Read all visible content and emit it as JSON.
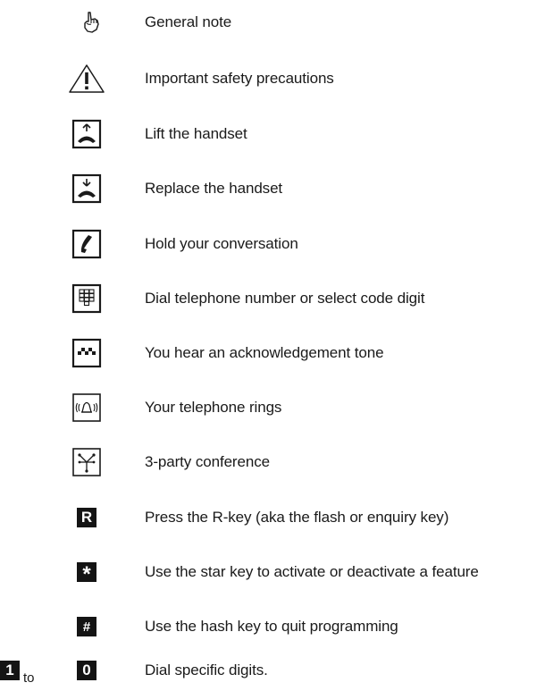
{
  "legend": [
    {
      "icon": "pointing-hand-icon",
      "label": "General note"
    },
    {
      "icon": "warning-triangle-icon",
      "label": "Important safety precautions"
    },
    {
      "icon": "lift-handset-icon",
      "label": "Lift the handset"
    },
    {
      "icon": "replace-handset-icon",
      "label": "Replace the handset"
    },
    {
      "icon": "hold-handset-icon",
      "label": "Hold your conversation"
    },
    {
      "icon": "keypad-icon",
      "label": "Dial telephone number or select code digit"
    },
    {
      "icon": "acknowledgement-tone-icon",
      "label": "You hear an acknowledgement tone"
    },
    {
      "icon": "ringing-bell-icon",
      "label": "Your telephone rings"
    },
    {
      "icon": "conference-icon",
      "label": "3-party conference"
    },
    {
      "icon": "r-key-icon",
      "label": "Press the R-key (aka the flash or enquiry key)",
      "key": "R"
    },
    {
      "icon": "star-key-icon",
      "label": "Use the star key to activate or deactivate a feature",
      "key": "*"
    },
    {
      "icon": "hash-key-icon",
      "label": "Use the hash key to quit programming",
      "key": "#"
    },
    {
      "icon": "digit-keys-icon",
      "label": "Dial specific digits.",
      "key_from": "1",
      "connector": "to",
      "key_to": "0"
    }
  ]
}
